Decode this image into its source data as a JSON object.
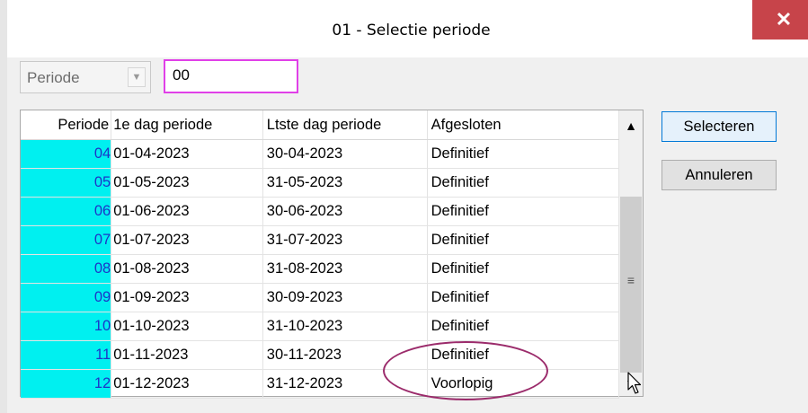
{
  "window": {
    "title": "01 - Selectie periode",
    "close_glyph": "✕"
  },
  "filter": {
    "combo_value": "Periode",
    "code_value": "00"
  },
  "table": {
    "headers": [
      "Periode",
      "1e dag periode",
      "Ltste dag periode",
      "Afgesloten"
    ],
    "rows": [
      [
        "04",
        "01-04-2023",
        "30-04-2023",
        "Definitief"
      ],
      [
        "05",
        "01-05-2023",
        "31-05-2023",
        "Definitief"
      ],
      [
        "06",
        "01-06-2023",
        "30-06-2023",
        "Definitief"
      ],
      [
        "07",
        "01-07-2023",
        "31-07-2023",
        "Definitief"
      ],
      [
        "08",
        "01-08-2023",
        "31-08-2023",
        "Definitief"
      ],
      [
        "09",
        "01-09-2023",
        "30-09-2023",
        "Definitief"
      ],
      [
        "10",
        "01-10-2023",
        "31-10-2023",
        "Definitief"
      ],
      [
        "11",
        "01-11-2023",
        "30-11-2023",
        "Definitief"
      ],
      [
        "12",
        "01-12-2023",
        "31-12-2023",
        "Voorlopig"
      ]
    ]
  },
  "buttons": {
    "select": "Selecteren",
    "cancel": "Annuleren"
  },
  "colors": {
    "period_cell_bg": "#00f0f0",
    "period_text": "#1d35c8",
    "highlight_input_border": "#e040e8",
    "annotation_ellipse": "#9b2b6b",
    "close_button": "#c7444a"
  },
  "icons": {
    "close": "close-icon",
    "combo_arrow": "chevron-down-icon",
    "scroll_up": "chevron-up-icon",
    "scroll_down": "chevron-down-icon",
    "cursor": "mouse-pointer-icon"
  }
}
